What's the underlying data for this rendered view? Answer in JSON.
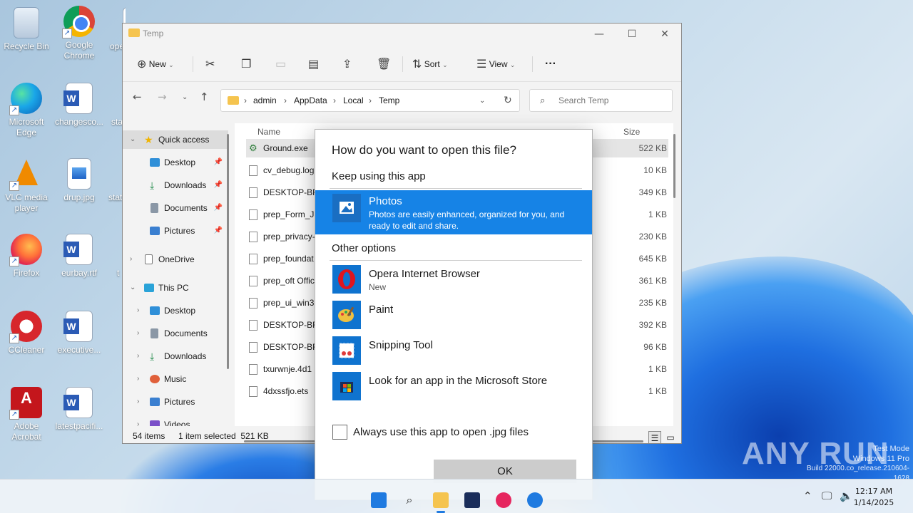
{
  "desktop": {
    "icons": [
      {
        "label": "Recycle Bin"
      },
      {
        "label": "Google Chrome"
      },
      {
        "label": "ope"
      },
      {
        "label": "Microsoft Edge"
      },
      {
        "label": "changesco..."
      },
      {
        "label": "sta"
      },
      {
        "label": "VLC media player"
      },
      {
        "label": "drup.jpg"
      },
      {
        "label": "stat"
      },
      {
        "label": "Firefox"
      },
      {
        "label": "eurbay.rtf"
      },
      {
        "label": "t"
      },
      {
        "label": "CCleaner"
      },
      {
        "label": "executive..."
      },
      {
        "label": "Adobe Acrobat"
      },
      {
        "label": "latestpacifi..."
      }
    ]
  },
  "explorer": {
    "title": "Temp",
    "controls": {
      "minimize": "—",
      "maximize": "☐",
      "close": "✕"
    },
    "toolbar": {
      "new_label": "New",
      "sort_label": "Sort",
      "view_label": "View",
      "more_label": "···"
    },
    "address": {
      "crumbs": [
        "admin",
        "AppData",
        "Local",
        "Temp"
      ],
      "separator": "›"
    },
    "search": {
      "placeholder": "Search Temp"
    },
    "nav": {
      "quick_access": "Quick access",
      "qa_items": [
        "Desktop",
        "Downloads",
        "Documents",
        "Pictures"
      ],
      "onedrive": "OneDrive",
      "this_pc": "This PC",
      "pc_items": [
        "Desktop",
        "Documents",
        "Downloads",
        "Music",
        "Pictures",
        "Videos"
      ]
    },
    "columns": {
      "name": "Name",
      "size": "Size"
    },
    "files": [
      {
        "name": "Ground.exe",
        "size": "522 KB"
      },
      {
        "name": "cv_debug.log",
        "size": "10 KB"
      },
      {
        "name": "DESKTOP-BFT",
        "size": "349 KB"
      },
      {
        "name": "prep_Form_JS",
        "size": "1 KB"
      },
      {
        "name": "prep_privacy-",
        "size": "230 KB"
      },
      {
        "name": "prep_foundat",
        "size": "645 KB"
      },
      {
        "name": "prep_oft Offic",
        "size": "361 KB"
      },
      {
        "name": "prep_ui_win32",
        "size": "235 KB"
      },
      {
        "name": "DESKTOP-BFT",
        "size": "392 KB"
      },
      {
        "name": "DESKTOP-BFT",
        "size": "96 KB"
      },
      {
        "name": "txurwnje.4d1",
        "size": "1 KB"
      },
      {
        "name": "4dxssfjo.ets",
        "size": "1 KB"
      }
    ],
    "status": {
      "count": "54 items",
      "selection": "1 item selected  521 KB"
    }
  },
  "dialog": {
    "title": "How do you want to open this file?",
    "keep_heading": "Keep using this app",
    "selected_app": {
      "name": "Photos",
      "desc": "Photos are easily enhanced, organized for you, and ready to edit and share."
    },
    "other_heading": "Other options",
    "apps": [
      {
        "name": "Opera Internet Browser",
        "sub": "New"
      },
      {
        "name": "Paint",
        "sub": ""
      },
      {
        "name": "Snipping Tool",
        "sub": ""
      },
      {
        "name": "Look for an app in the Microsoft Store",
        "sub": ""
      }
    ],
    "checkbox_label": "Always use this app to open .jpg files",
    "ok_label": "OK"
  },
  "taskbar": {
    "time": "12:17 AM",
    "date": "1/14/2025"
  },
  "watermark": {
    "line1": "Test Mode",
    "line2": "Windows 11 Pro",
    "line3": "Build 22000.co_release.210604-1628",
    "brand": "ANY RUN"
  },
  "colors": {
    "accent": "#1683e6",
    "ok_button": "#cccccc",
    "folder": "#f5c44f"
  }
}
